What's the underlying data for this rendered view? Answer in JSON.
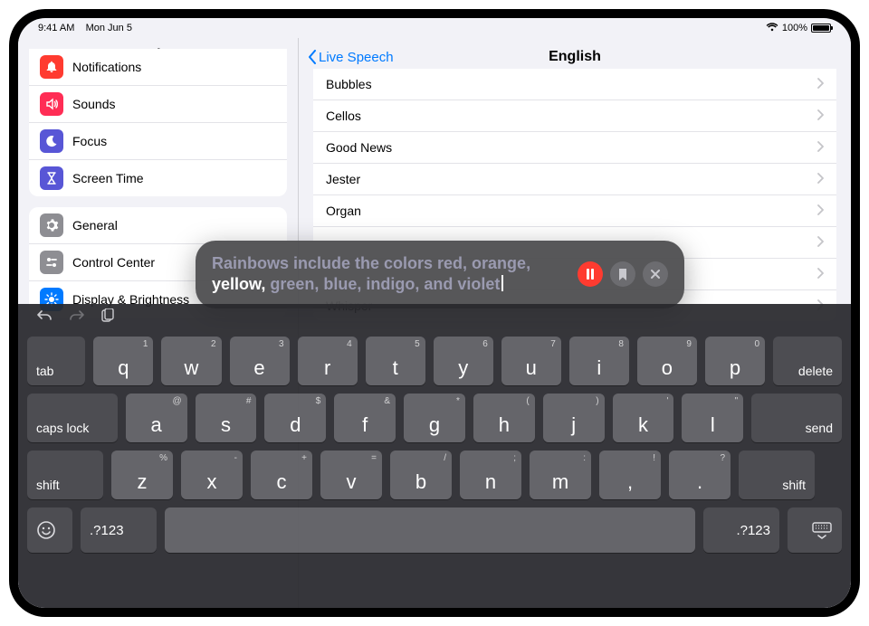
{
  "statusbar": {
    "time": "9:41 AM",
    "date": "Mon Jun 5",
    "battery": "100%"
  },
  "sidebar": {
    "title": "Settings",
    "group1": [
      {
        "label": "Notifications",
        "color": "#ff3b30",
        "icon": "bell"
      },
      {
        "label": "Sounds",
        "color": "#ff2d55",
        "icon": "speaker"
      },
      {
        "label": "Focus",
        "color": "#5856d6",
        "icon": "moon"
      },
      {
        "label": "Screen Time",
        "color": "#5856d6",
        "icon": "hourglass"
      }
    ],
    "group2": [
      {
        "label": "General",
        "color": "#8e8e93",
        "icon": "gear"
      },
      {
        "label": "Control Center",
        "color": "#8e8e93",
        "icon": "switches"
      },
      {
        "label": "Display & Brightness",
        "color": "#007aff",
        "icon": "sun"
      }
    ]
  },
  "detail": {
    "back": "Live Speech",
    "title": "English",
    "voices": [
      "Bubbles",
      "Cellos",
      "Good News",
      "Jester",
      "Organ",
      "",
      "",
      "Whisper"
    ]
  },
  "bubble": {
    "dim1": "Rainbows include the colors red, orange, ",
    "bright": "yellow,",
    "dim2": " green, blue, indigo, and violet"
  },
  "kb": {
    "tab": "tab",
    "delete": "delete",
    "caps": "caps lock",
    "send": "send",
    "shift": "shift",
    "numsym": ".?123",
    "row1": [
      {
        "k": "q",
        "s": "1"
      },
      {
        "k": "w",
        "s": "2"
      },
      {
        "k": "e",
        "s": "3"
      },
      {
        "k": "r",
        "s": "4"
      },
      {
        "k": "t",
        "s": "5"
      },
      {
        "k": "y",
        "s": "6"
      },
      {
        "k": "u",
        "s": "7"
      },
      {
        "k": "i",
        "s": "8"
      },
      {
        "k": "o",
        "s": "9"
      },
      {
        "k": "p",
        "s": "0"
      }
    ],
    "row2": [
      {
        "k": "a",
        "s": "@"
      },
      {
        "k": "s",
        "s": "#"
      },
      {
        "k": "d",
        "s": "$"
      },
      {
        "k": "f",
        "s": "&"
      },
      {
        "k": "g",
        "s": "*"
      },
      {
        "k": "h",
        "s": "("
      },
      {
        "k": "j",
        "s": ")"
      },
      {
        "k": "k",
        "s": "'"
      },
      {
        "k": "l",
        "s": "\""
      }
    ],
    "row3": [
      {
        "k": "z",
        "s": "%"
      },
      {
        "k": "x",
        "s": "-"
      },
      {
        "k": "c",
        "s": "+"
      },
      {
        "k": "v",
        "s": "="
      },
      {
        "k": "b",
        "s": "/"
      },
      {
        "k": "n",
        "s": ";"
      },
      {
        "k": "m",
        "s": ":"
      },
      {
        "k": ",",
        "s": "!"
      },
      {
        "k": ".",
        "s": "?"
      }
    ]
  }
}
